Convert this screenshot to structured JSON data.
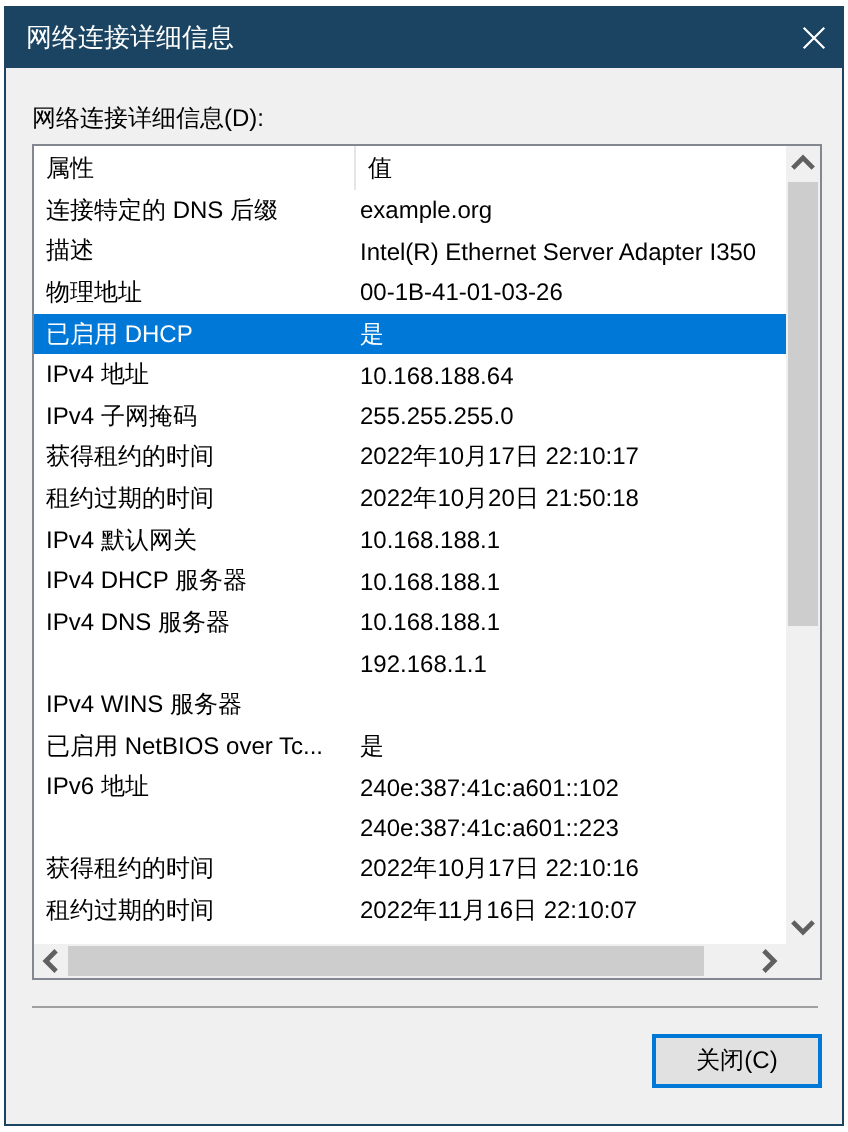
{
  "window": {
    "title": "网络连接详细信息"
  },
  "list_label": "网络连接详细信息(D):",
  "columns": [
    "属性",
    "值"
  ],
  "rows": [
    {
      "property": "连接特定的 DNS 后缀",
      "value": "example.org",
      "selected": false
    },
    {
      "property": "描述",
      "value": "Intel(R) Ethernet Server Adapter I350",
      "selected": false
    },
    {
      "property": "物理地址",
      "value": "00-1B-41-01-03-26",
      "selected": false
    },
    {
      "property": "已启用 DHCP",
      "value": "是",
      "selected": true
    },
    {
      "property": "IPv4 地址",
      "value": "10.168.188.64",
      "selected": false
    },
    {
      "property": "IPv4 子网掩码",
      "value": "255.255.255.0",
      "selected": false
    },
    {
      "property": "获得租约的时间",
      "value": "2022年10月17日 22:10:17",
      "selected": false
    },
    {
      "property": "租约过期的时间",
      "value": "2022年10月20日 21:50:18",
      "selected": false
    },
    {
      "property": "IPv4 默认网关",
      "value": "10.168.188.1",
      "selected": false
    },
    {
      "property": "IPv4 DHCP 服务器",
      "value": "10.168.188.1",
      "selected": false
    },
    {
      "property": "IPv4 DNS 服务器",
      "value": "10.168.188.1",
      "selected": false
    },
    {
      "property": "",
      "value": "192.168.1.1",
      "selected": false
    },
    {
      "property": "IPv4 WINS 服务器",
      "value": "",
      "selected": false
    },
    {
      "property": "已启用 NetBIOS over Tc...",
      "value": "是",
      "selected": false
    },
    {
      "property": "IPv6 地址",
      "value": "240e:387:41c:a601::102",
      "selected": false
    },
    {
      "property": "",
      "value": "240e:387:41c:a601::223",
      "selected": false
    },
    {
      "property": "获得租约的时间",
      "value": "2022年10月17日 22:10:16",
      "selected": false
    },
    {
      "property": "租约过期的时间",
      "value": "2022年11月16日 22:10:07",
      "selected": false
    }
  ],
  "buttons": [
    {
      "label": "关闭(C)",
      "default": true
    }
  ]
}
